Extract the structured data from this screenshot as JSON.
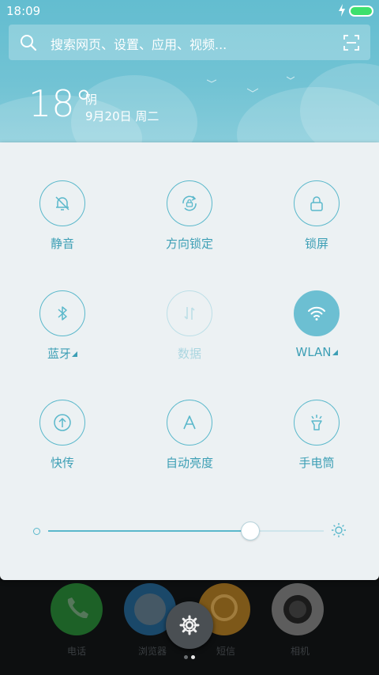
{
  "status_bar": {
    "time": "18:09"
  },
  "search": {
    "placeholder": "搜索网页、设置、应用、视频..."
  },
  "weather": {
    "temperature": "18°",
    "condition": "阴",
    "date": "9月20日 周二"
  },
  "quick_settings": {
    "tiles": [
      {
        "label": "静音",
        "icon": "bell-off-icon",
        "state": "off"
      },
      {
        "label": "方向锁定",
        "icon": "rotation-lock-icon",
        "state": "off"
      },
      {
        "label": "锁屏",
        "icon": "lock-icon",
        "state": "off"
      },
      {
        "label": "蓝牙",
        "icon": "bluetooth-icon",
        "state": "off"
      },
      {
        "label": "数据",
        "icon": "mobile-data-icon",
        "state": "disabled"
      },
      {
        "label": "WLAN",
        "icon": "wifi-icon",
        "state": "on"
      },
      {
        "label": "快传",
        "icon": "share-upload-icon",
        "state": "off"
      },
      {
        "label": "自动亮度",
        "icon": "auto-brightness-icon",
        "state": "off"
      },
      {
        "label": "手电筒",
        "icon": "flashlight-icon",
        "state": "off"
      }
    ],
    "brightness": {
      "level": 0.734
    }
  },
  "dock": {
    "apps": [
      {
        "label": "电话",
        "icon": "phone-icon",
        "color": "#2f9a3e"
      },
      {
        "label": "浏览器",
        "icon": "browser-icon",
        "color": "#2d7fb0"
      },
      {
        "label": "短信",
        "icon": "message-icon",
        "color": "#e0a12a"
      },
      {
        "label": "相机",
        "icon": "camera-icon",
        "color": "#bdbdbd"
      }
    ]
  },
  "colors": {
    "accent": "#5ab8cb",
    "header": "#6ec1d3",
    "panel": "#ecf1f3"
  }
}
